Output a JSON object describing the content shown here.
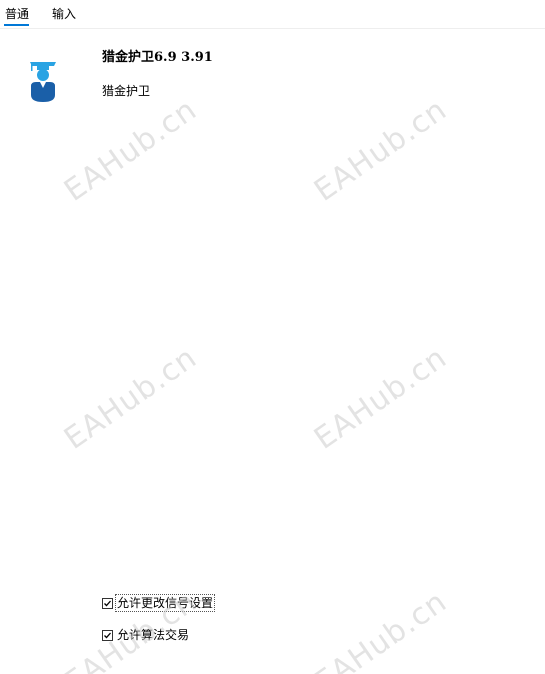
{
  "tabs": [
    {
      "label": "普通",
      "active": true
    },
    {
      "label": "输入",
      "active": false
    }
  ],
  "accent_color": "#0078d7",
  "ea": {
    "icon": "graduate-person-icon",
    "title": "猎金护卫6.9 3.91",
    "description": "猎金护卫"
  },
  "options": [
    {
      "label": "允许更改信号设置",
      "checked": true,
      "focused": true
    },
    {
      "label": "允许算法交易",
      "checked": true,
      "focused": false
    }
  ],
  "watermark": {
    "text": "EAHub.cn"
  }
}
